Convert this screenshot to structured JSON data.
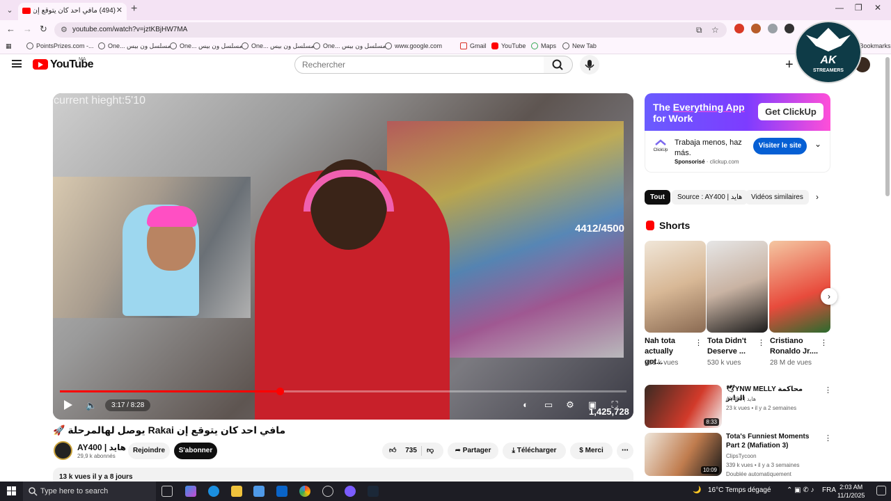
{
  "browser": {
    "tab_title": "(494) مافي احد كان يتوقع إن Rakai",
    "url": "youtube.com/watch?v=jztKBjHW7MA",
    "bookmarks": [
      {
        "label": "PointsPrizes.com -..."
      },
      {
        "label": "One... مسلسل ون بيس"
      },
      {
        "label": "One... مسلسل ون بيس"
      },
      {
        "label": "One... مسلسل ون بيس"
      },
      {
        "label": "One... مسلسل ون بيس"
      },
      {
        "label": "www.google.com"
      },
      {
        "label": "Gmail"
      },
      {
        "label": "YouTube"
      },
      {
        "label": "Maps"
      },
      {
        "label": "New Tab"
      }
    ],
    "all_bookmarks": "All Bookmarks"
  },
  "watermark": {
    "line1": "AK",
    "line2": "STREAMERS"
  },
  "youtube": {
    "logo_text": "YouTube",
    "country_code": "MA",
    "search_placeholder": "Rechercher"
  },
  "player": {
    "overlay_height": "current hieght:5'10",
    "overlay_count": "4412/4500",
    "overlay_views": "1,425,728",
    "time_current": "3:17",
    "time_total": "8:28",
    "time_display": "3:17 / 8:28",
    "progress_fraction": 0.388
  },
  "video": {
    "title": "🚀 يوصل لهالمرحلة Rakai مافي احد كان يتوقع إن",
    "channel_name": "AY400 | هايد",
    "subscribers": "29,9 k abonnés",
    "join_label": "Rejoindre",
    "subscribe_label": "S'abonner",
    "likes": "735",
    "share_label": "Partager",
    "download_label": "Télécharger",
    "thanks_label": "Merci",
    "description_meta": "13 k vues  il y a 8 jours"
  },
  "ad": {
    "headline_part1": "The ",
    "headline_highlight": "Everything App",
    "headline_part2": " for Work",
    "cta": "Get ClickUp",
    "logo_text": "ClickUp",
    "text": "Trabaja menos, haz más.",
    "sponsored": "Sponsorisé",
    "domain": "clickup.com",
    "visit_label": "Visiter le site"
  },
  "chips": [
    "Tout",
    "Source : AY400 | هايد",
    "Vidéos similaires"
  ],
  "shorts": {
    "label": "Shorts",
    "items": [
      {
        "title": "Nah tota actually got...",
        "views": "381 k vues"
      },
      {
        "title": "Tota Didn't Deserve ...",
        "views": "530 k vues"
      },
      {
        "title": "Cristiano Ronaldo Jr....",
        "views": "28 M de vues"
      }
    ]
  },
  "recommended": [
    {
      "title": "🕊YNW MELLY محاكمة الرابر",
      "channel": "AY400 | هايد",
      "meta": "23 k vues  •  il y a 2 semaines",
      "duration": "8:33",
      "extra": ""
    },
    {
      "title": "Tota's Funniest Moments Part 2 (Mafiation 3)",
      "channel": "ClipsTycoon",
      "meta": "339 k vues  •  il y a 3 semaines",
      "duration": "10:09",
      "extra": "Doublée automatiquement"
    }
  ],
  "taskbar": {
    "search_placeholder": "Type here to search",
    "weather": "16°C  Temps dégagé",
    "language": "FRA",
    "time": "2:03 AM",
    "date": "11/1/2025"
  }
}
